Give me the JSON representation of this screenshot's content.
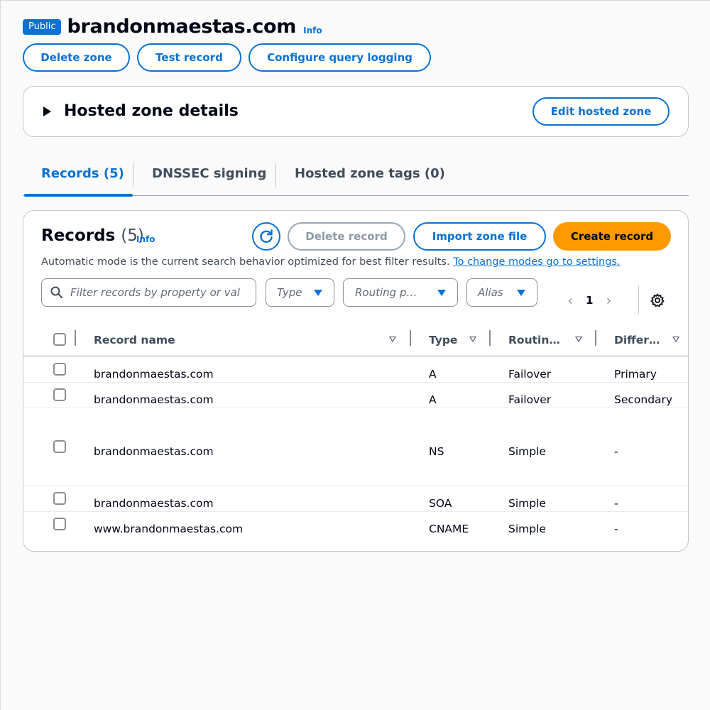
{
  "header": {
    "badge": "Public",
    "title": "brandonmaestas.com",
    "info": "Info",
    "buttons": {
      "delete_zone": "Delete zone",
      "test_record": "Test record",
      "configure_query_logging": "Configure query logging"
    }
  },
  "details": {
    "title": "Hosted zone details",
    "edit_button": "Edit hosted zone"
  },
  "tabs": [
    {
      "label": "Records (5)",
      "active": true
    },
    {
      "label": "DNSSEC signing",
      "active": false
    },
    {
      "label": "Hosted zone tags (0)",
      "active": false
    }
  ],
  "records": {
    "title": "Records",
    "count": "(5)",
    "info": "Info",
    "delete_button": "Delete record",
    "import_button": "Import zone file",
    "create_button": "Create record",
    "mode_text": "Automatic mode is the current search behavior optimized for best filter results.",
    "mode_link": "To change modes go to settings.",
    "search_placeholder": "Filter records by property or val",
    "filters": {
      "type": "Type",
      "routing": "Routing p…",
      "alias": "Alias"
    },
    "page": "1",
    "columns": {
      "name": "Record name",
      "type": "Type",
      "routing": "Routin…",
      "differ": "Differ…"
    },
    "rows": [
      {
        "name": "brandonmaestas.com",
        "type": "A",
        "routing": "Failover",
        "differ": "Primary"
      },
      {
        "name": "brandonmaestas.com",
        "type": "A",
        "routing": "Failover",
        "differ": "Secondary"
      },
      {
        "name": "brandonmaestas.com",
        "type": "NS",
        "routing": "Simple",
        "differ": "-"
      },
      {
        "name": "brandonmaestas.com",
        "type": "SOA",
        "routing": "Simple",
        "differ": "-"
      },
      {
        "name": "www.brandonmaestas.com",
        "type": "CNAME",
        "routing": "Simple",
        "differ": "-"
      }
    ]
  },
  "colors": {
    "accent": "#0972d3",
    "primary_button": "#ff9900",
    "text": "#000716"
  }
}
